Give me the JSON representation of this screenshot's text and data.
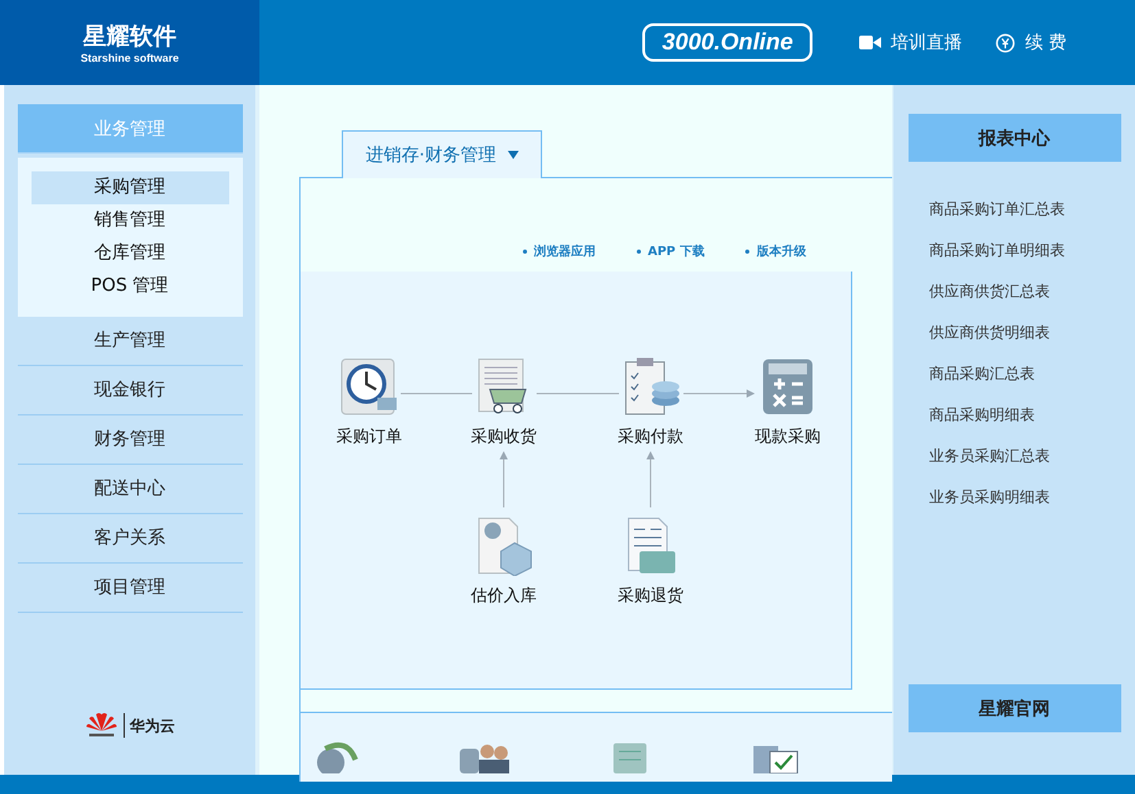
{
  "header": {
    "logo_title": "星耀软件",
    "logo_subtitle": "Starshine software",
    "badge": "3000.Online",
    "links": [
      {
        "kind": "video",
        "label": "培训直播"
      },
      {
        "kind": "renew",
        "label": "续 费"
      }
    ]
  },
  "sidebar": {
    "group_title": "业务管理",
    "subitems": [
      {
        "label": "采购管理",
        "selected": true
      },
      {
        "label": "销售管理",
        "selected": false
      },
      {
        "label": "仓库管理",
        "selected": false
      },
      {
        "label": "POS 管理",
        "selected": false
      }
    ],
    "items": [
      "生产管理",
      "现金银行",
      "财务管理",
      "配送中心",
      "客户关系",
      "项目管理"
    ],
    "partner": "华为云"
  },
  "main": {
    "tab": "进销存·财务管理",
    "links": [
      "浏览器应用",
      "APP 下载",
      "版本升级"
    ],
    "nodes": [
      {
        "kind": "clock",
        "label": "采购订单"
      },
      {
        "kind": "cart",
        "label": "采购收货"
      },
      {
        "kind": "clipboard",
        "label": "采购付款"
      },
      {
        "kind": "calculator",
        "label": "现款采购"
      },
      {
        "kind": "box",
        "label": "估价入库"
      },
      {
        "kind": "invoice",
        "label": "采购退货"
      }
    ]
  },
  "reports": {
    "title": "报表中心",
    "items": [
      "商品采购订单汇总表",
      "商品采购订单明细表",
      "供应商供货汇总表",
      "供应商供货明细表",
      "商品采购汇总表",
      "商品采购明细表",
      "业务员采购汇总表",
      "业务员采购明细表"
    ],
    "footer_button": "星耀官网"
  }
}
